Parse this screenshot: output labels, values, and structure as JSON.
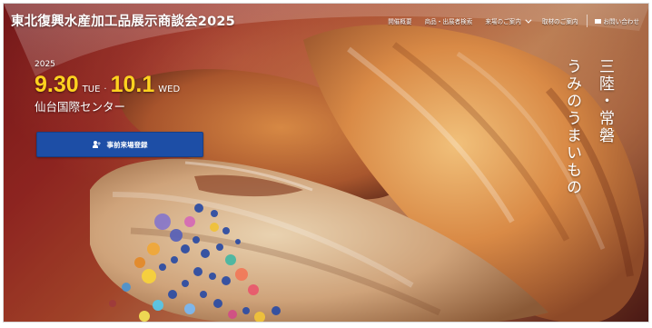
{
  "header": {
    "logo_text": "東北復興水産加工品展示商談会2025",
    "nav": [
      {
        "label": "開催概要"
      },
      {
        "label": "商品・出展者検索"
      },
      {
        "label": "来場のご案内"
      },
      {
        "label": "取材のご案内"
      },
      {
        "label": "お問い合わせ"
      }
    ]
  },
  "event": {
    "year": "2025",
    "date1": "9.30",
    "dow1": "TUE",
    "sep": "·",
    "date2": "10.1",
    "dow2": "WED",
    "venue": "仙台国際センター"
  },
  "cta": {
    "register_label": "事前来場登録"
  },
  "tagline": {
    "line1": "三陸・常磐",
    "line2": "うみのうまいもの"
  },
  "colors": {
    "accent_yellow": "#ffd21f",
    "button_blue": "#1d4ea6",
    "hero_red": "#9c2a25"
  },
  "icons": {
    "mail": "mail-icon",
    "user_add": "user-plus-icon",
    "dropdown": "chevron-down-icon"
  }
}
